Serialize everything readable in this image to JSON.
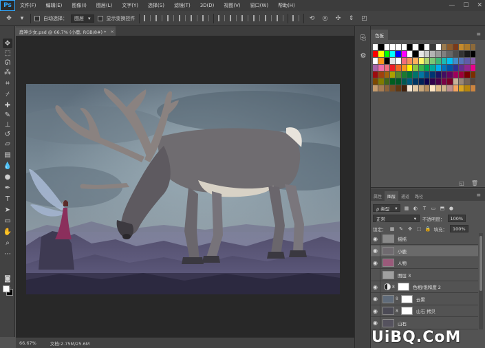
{
  "app": {
    "logo": "Ps",
    "window_controls": [
      "—",
      "☐",
      "✕"
    ]
  },
  "menu": [
    "文件(F)",
    "编辑(E)",
    "图像(I)",
    "图层(L)",
    "文字(Y)",
    "选择(S)",
    "滤镜(T)",
    "3D(D)",
    "视图(V)",
    "窗口(W)",
    "帮助(H)"
  ],
  "options": {
    "auto_select_label": "自动选择：",
    "auto_select_value": "图层",
    "transform_label": "显示变换控件"
  },
  "document": {
    "tab_title": "鹿神少女.psd @ 66.7% (小鹿, RGB/8#) *",
    "tab_close": "×"
  },
  "status": {
    "zoom": "66.67%",
    "doc_size": "文档:2.75M/25.6M"
  },
  "swatches_panel": {
    "tab": "色板",
    "menu_icon": "≡",
    "footer_icons": [
      "new-swatch-icon",
      "trash-icon"
    ],
    "rows": [
      [
        "#ffffff",
        "#000000",
        "#ffffff",
        "#ffffff",
        "#ffffff",
        "#ffffff",
        "#000000",
        "#ffffff",
        "#000000",
        "#ffffff",
        "#3a3a3a",
        "#ffffff",
        "#9a7b4f",
        "#8a5a2b",
        "#7a3a1a",
        "#c48a2c",
        "#ad7a2a",
        "#8c6a3a"
      ],
      [
        "#ff0000",
        "#ffff00",
        "#00ff00",
        "#00ffff",
        "#0000ff",
        "#ff00ff",
        "#ffffff",
        "#000000",
        "#e6e6e6",
        "#cccccc",
        "#b3b3b3",
        "#999999",
        "#808080",
        "#666666",
        "#4d4d4d",
        "#333333",
        "#1a1a1a",
        "#000000"
      ],
      [
        "#ffffff",
        "#f7941d",
        "#000000",
        "#e0e0e0",
        "#ffffff",
        "#f26d7d",
        "#f68e56",
        "#fbaf5d",
        "#fff568",
        "#acd372",
        "#7cc576",
        "#3bb878",
        "#1abbb4",
        "#00bff3",
        "#438ccb",
        "#5574b9",
        "#605ca8",
        "#855fa8"
      ],
      [
        "#a864a8",
        "#f06ea9",
        "#f26c7d",
        "#ed1c24",
        "#f26522",
        "#f7941d",
        "#fff200",
        "#8dc63f",
        "#39b54a",
        "#00a651",
        "#00a99d",
        "#00aeef",
        "#0072bc",
        "#0054a6",
        "#2e3192",
        "#662d91",
        "#92278f",
        "#ec008c"
      ],
      [
        "#9e0b0f",
        "#a0410d",
        "#a3620a",
        "#aba000",
        "#598527",
        "#1a7b30",
        "#007236",
        "#00746b",
        "#0076a3",
        "#004b80",
        "#003471",
        "#1b1464",
        "#440e62",
        "#630460",
        "#9e005d",
        "#9e0039",
        "#790000",
        "#7b2e00"
      ],
      [
        "#7d4900",
        "#827b00",
        "#406618",
        "#005e20",
        "#005826",
        "#005952",
        "#005b7f",
        "#003663",
        "#002157",
        "#0d004c",
        "#32004b",
        "#4b0049",
        "#7b0046",
        "#7a0026",
        "#c7b299",
        "#998675",
        "#736357",
        "#534741"
      ],
      [
        "#c69c6d",
        "#a67c52",
        "#8c6239",
        "#754c24",
        "#603813",
        "#42210b",
        "#f5e6d3",
        "#e0c9a6",
        "#c9a87c",
        "#b38b5d",
        "#ffe4c4",
        "#deb887",
        "#d2b48c",
        "#bc8f8f",
        "#f4a460",
        "#daa520",
        "#b8860b",
        "#cd853f"
      ]
    ]
  },
  "layers_panel": {
    "tabs": [
      "属性",
      "图层",
      "通道",
      "路径"
    ],
    "active_tab": "图层",
    "filter_label": "ρ 类型",
    "blend_mode": "正常",
    "opacity_label": "不透明度：",
    "opacity_value": "100%",
    "lock_label": "锁定：",
    "fill_label": "填充：",
    "fill_value": "100%",
    "layers": [
      {
        "name": "摇摇",
        "visible": true,
        "selected": false,
        "thumb": "#8a8a8a",
        "mask": false,
        "adjust": false
      },
      {
        "name": "小鹿",
        "visible": true,
        "selected": true,
        "thumb": "#6f6a6f",
        "mask": false,
        "adjust": false
      },
      {
        "name": "人物",
        "visible": true,
        "selected": false,
        "thumb": "#9a5a7a",
        "mask": false,
        "adjust": false
      },
      {
        "name": "图层 3",
        "visible": false,
        "selected": false,
        "thumb": "#a0a0a0",
        "mask": false,
        "adjust": false
      },
      {
        "name": "色相/饱和度 2",
        "visible": true,
        "selected": false,
        "thumb": "",
        "mask": true,
        "adjust": true
      },
      {
        "name": "云雾",
        "visible": true,
        "selected": false,
        "thumb": "#5f6b7a",
        "mask": true,
        "adjust": false
      },
      {
        "name": "山石 拷贝",
        "visible": true,
        "selected": false,
        "thumb": "#4b4a55",
        "mask": true,
        "adjust": false
      },
      {
        "name": "山石",
        "visible": true,
        "selected": false,
        "thumb": "#55525e",
        "mask": false,
        "adjust": false
      }
    ]
  },
  "watermark": "UiBQ.CoM"
}
